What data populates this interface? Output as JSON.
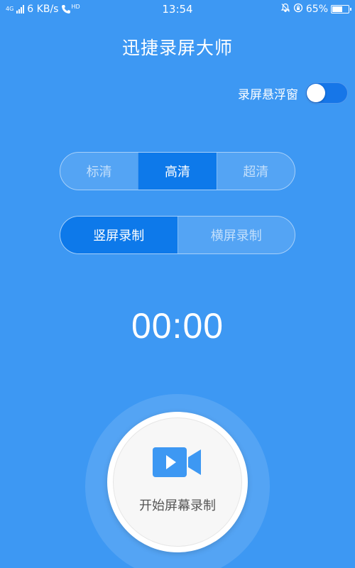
{
  "status_bar": {
    "network_type": "4G",
    "speed": "6 KB/s",
    "hd_badge": "HD",
    "time": "13:54",
    "battery": "65%",
    "battery_level": 0.65
  },
  "app_title": "迅捷录屏大师",
  "floating_window": {
    "label": "录屏悬浮窗",
    "enabled": false
  },
  "quality_options": [
    "标清",
    "高清",
    "超清"
  ],
  "quality_selected": "高清",
  "orientation_options": [
    "竖屏录制",
    "横屏录制"
  ],
  "orientation_selected": "竖屏录制",
  "timer": "00:00",
  "record_button": {
    "label": "开始屏幕录制",
    "icon": "video-camera-icon"
  },
  "colors": {
    "background": "#3d98f3",
    "active_segment": "#0d79ea",
    "icon_blue": "#3d98f3"
  }
}
